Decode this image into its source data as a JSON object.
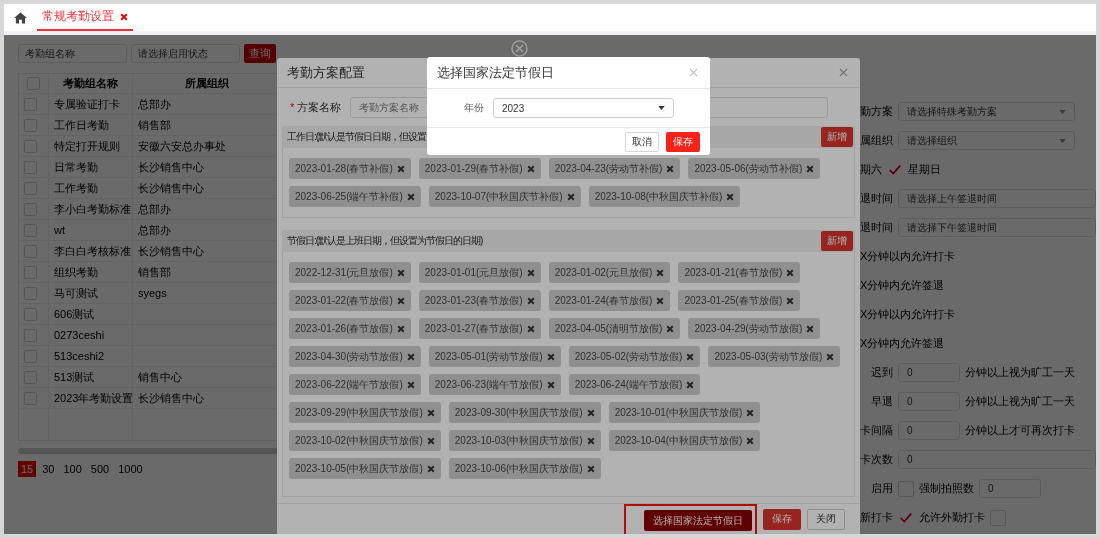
{
  "top_bar": {
    "tabs": [
      {
        "label": "常规考勤设置",
        "selected": true,
        "closable": true
      }
    ]
  },
  "search": {
    "fields": [
      {
        "placeholder": "考勤组名称"
      },
      {
        "placeholder": "请选择启用状态"
      }
    ],
    "button": "查询"
  },
  "table": {
    "select_all_checked": false,
    "columns": [
      "考勤组名称",
      "所属组织"
    ],
    "rows": [
      {
        "checked": false,
        "name": "专属验证打卡",
        "org": "总部办"
      },
      {
        "checked": false,
        "name": "工作日考勤",
        "org": "销售部"
      },
      {
        "checked": false,
        "name": "特定打开规则",
        "org": "安徽六安总办事处"
      },
      {
        "checked": false,
        "name": "日常考勤",
        "org": "长沙销售中心"
      },
      {
        "checked": false,
        "name": "工作考勤",
        "org": "长沙销售中心"
      },
      {
        "checked": false,
        "name": "李小白考勤标准",
        "org": "总部办"
      },
      {
        "checked": false,
        "name": "wt",
        "org": "总部办"
      },
      {
        "checked": false,
        "name": "李白白考核标准",
        "org": "长沙销售中心"
      },
      {
        "checked": false,
        "name": "组织考勤",
        "org": "销售部"
      },
      {
        "checked": false,
        "name": "马可测试",
        "org": "syegs"
      },
      {
        "checked": false,
        "name": "606测试"
      },
      {
        "checked": false,
        "name": "0273ceshi"
      },
      {
        "checked": false,
        "name": "513ceshi2"
      },
      {
        "checked": false,
        "name": "513测试",
        "org": "销售中心"
      },
      {
        "checked": false,
        "name": "2023年考勤设置",
        "org": "长沙销售中心"
      }
    ]
  },
  "pagination": [
    {
      "label": "15",
      "selected": true
    },
    {
      "label": "30",
      "selected": false
    },
    {
      "label": "100",
      "selected": false
    },
    {
      "label": "500",
      "selected": false
    },
    {
      "label": "1000",
      "selected": false
    }
  ],
  "form": {
    "rows": [
      {
        "label": "勤方案",
        "parts": [
          {
            "kind": "select",
            "placeholder": "请选择特殊考勤方案"
          }
        ]
      },
      {
        "label": "属组织",
        "parts": [
          {
            "kind": "select",
            "placeholder": "请选择组织"
          }
        ]
      },
      {
        "parts": [
          {
            "kind": "text",
            "text": "期六"
          },
          {
            "kind": "checkbox",
            "checked": true
          },
          {
            "kind": "text",
            "text": "星期日"
          }
        ]
      },
      {
        "label": "退时间",
        "parts": [
          {
            "kind": "input",
            "placeholder": "请选择上午签退时间"
          }
        ]
      },
      {
        "label": "退时间",
        "parts": [
          {
            "kind": "input",
            "placeholder": "请选择下午签退时间"
          }
        ]
      },
      {
        "parts": [
          {
            "kind": "text",
            "text": "X分钟以内允许打卡"
          }
        ]
      },
      {
        "parts": [
          {
            "kind": "text",
            "text": "X分钟内允许签退"
          }
        ]
      },
      {
        "parts": [
          {
            "kind": "text",
            "text": "X分钟以内允许打卡"
          }
        ]
      },
      {
        "parts": [
          {
            "kind": "text",
            "text": "X分钟内允许签退"
          }
        ]
      },
      {
        "label": "迟到",
        "parts": [
          {
            "kind": "short_input",
            "value": "0"
          },
          {
            "kind": "text",
            "text": "分钟以上视为旷工一天"
          }
        ]
      },
      {
        "label": "早退",
        "parts": [
          {
            "kind": "short_input",
            "value": "0"
          },
          {
            "kind": "text",
            "text": "分钟以上视为旷工一天"
          }
        ]
      },
      {
        "label": "卡间隔",
        "parts": [
          {
            "kind": "short_input",
            "value": "0"
          },
          {
            "kind": "text",
            "text": "分钟以上才可再次打卡"
          }
        ]
      },
      {
        "label": "卡次数",
        "parts": [
          {
            "kind": "input",
            "value": "0"
          }
        ]
      },
      {
        "label": "启用",
        "parts": [
          {
            "kind": "checkbox",
            "checked": false
          },
          {
            "kind": "text",
            "text": "强制拍照数"
          },
          {
            "kind": "short_input",
            "value": "0"
          }
        ]
      },
      {
        "label": "新打卡",
        "parts": [
          {
            "kind": "checkbox",
            "checked": true
          },
          {
            "kind": "text",
            "text": "允许外勤打卡"
          },
          {
            "kind": "checkbox",
            "checked": false
          }
        ]
      }
    ]
  },
  "scheme_dialog": {
    "title": "考勤方案配置",
    "name_field": {
      "required_mark": "*",
      "label": "方案名称",
      "placeholder": "考勤方案名称"
    },
    "sections": [
      {
        "header": "工作日:(默认是节假日日期，但设置",
        "button": "新增",
        "tags": [
          "2023-01-28(春节补假)",
          "2023-01-29(春节补假)",
          "2023-04-23(劳动节补假)",
          "2023-05-06(劳动节补假)",
          "2023-06-25(端午节补假)",
          "2023-10-07(中秋国庆节补假)",
          "2023-10-08(中秋国庆节补假)"
        ]
      },
      {
        "header": "节假日:(默认是上班日期，但设置为节假日的日期)",
        "button": "新增",
        "tags": [
          "2022-12-31(元旦放假)",
          "2023-01-01(元旦放假)",
          "2023-01-02(元旦放假)",
          "2023-01-21(春节放假)",
          "2023-01-22(春节放假)",
          "2023-01-23(春节放假)",
          "2023-01-24(春节放假)",
          "2023-01-25(春节放假)",
          "2023-01-26(春节放假)",
          "2023-01-27(春节放假)",
          "2023-04-05(清明节放假)",
          "2023-04-29(劳动节放假)",
          "2023-04-30(劳动节放假)",
          "2023-05-01(劳动节放假)",
          "2023-05-02(劳动节放假)",
          "2023-05-03(劳动节放假)",
          "2023-06-22(端午节放假)",
          "2023-06-23(端午节放假)",
          "2023-06-24(端午节放假)",
          "2023-09-29(中秋国庆节放假)",
          "2023-09-30(中秋国庆节放假)",
          "2023-10-01(中秋国庆节放假)",
          "2023-10-02(中秋国庆节放假)",
          "2023-10-03(中秋国庆节放假)",
          "2023-10-04(中秋国庆节放假)",
          "2023-10-05(中秋国庆节放假)",
          "2023-10-06(中秋国庆节放假)"
        ]
      }
    ],
    "footer_buttons": [
      {
        "label": "选择国家法定节假日",
        "kind": "dark",
        "highlighted": true
      },
      {
        "label": "保存",
        "kind": "primary",
        "highlighted": false
      },
      {
        "label": "关闭",
        "kind": "default",
        "highlighted": false
      }
    ]
  },
  "holiday_dialog": {
    "title": "选择国家法定节假日",
    "year_label": "年份",
    "year": "2023",
    "buttons": [
      {
        "label": "取消",
        "kind": "default"
      },
      {
        "label": "保存",
        "kind": "primary"
      }
    ]
  }
}
